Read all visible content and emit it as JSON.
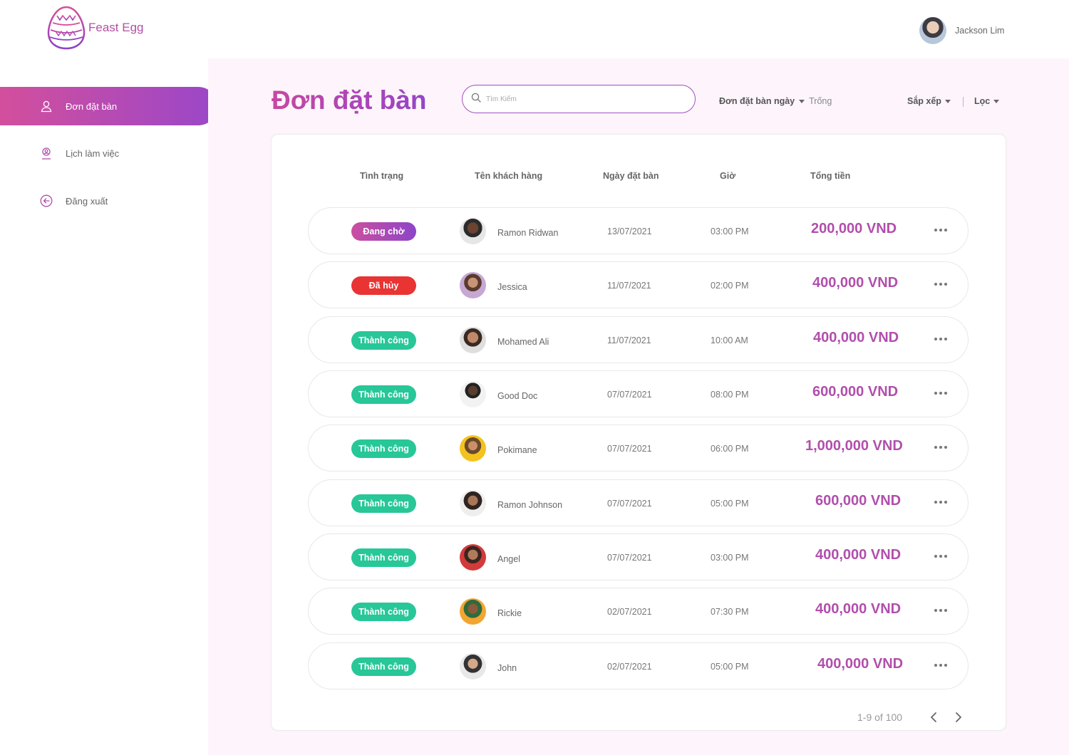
{
  "app": {
    "name": "Feast Egg"
  },
  "user": {
    "name": "Jackson Lim"
  },
  "sidebar": {
    "items": [
      {
        "label": "Đơn đặt bàn",
        "active": true,
        "icon": "user-icon"
      },
      {
        "label": "Lịch làm việc",
        "active": false,
        "icon": "location-user-icon"
      },
      {
        "label": "Đăng xuất",
        "active": false,
        "icon": "logout-arrow-icon"
      }
    ]
  },
  "header": {
    "title": "Đơn đặt bàn",
    "search_placeholder": "Tìm Kiếm",
    "filter_date_label": "Đơn đặt bàn ngày",
    "filter_date_value": "Trống",
    "sort_label": "Sắp xếp",
    "filter_label": "Lọc"
  },
  "table": {
    "columns": [
      "Tình trạng",
      "Tên khách hàng",
      "Ngày đặt bàn",
      "Giờ",
      "Tổng tiền"
    ],
    "rows": [
      {
        "status": "Đang chờ",
        "status_type": "pending",
        "customer": "Ramon Ridwan",
        "date": "13/07/2021",
        "time": "03:00 PM",
        "total": "200,000 VND"
      },
      {
        "status": "Đã hủy",
        "status_type": "cancel",
        "customer": "Jessica",
        "date": "11/07/2021",
        "time": "02:00 PM",
        "total": "400,000 VND"
      },
      {
        "status": "Thành công",
        "status_type": "success",
        "customer": "Mohamed Ali",
        "date": "11/07/2021",
        "time": "10:00 AM",
        "total": "400,000 VND"
      },
      {
        "status": "Thành công",
        "status_type": "success",
        "customer": "Good Doc",
        "date": "07/07/2021",
        "time": "08:00 PM",
        "total": "600,000 VND"
      },
      {
        "status": "Thành công",
        "status_type": "success",
        "customer": "Pokimane",
        "date": "07/07/2021",
        "time": "06:00 PM",
        "total": "1,000,000 VND"
      },
      {
        "status": "Thành công",
        "status_type": "success",
        "customer": "Ramon Johnson",
        "date": "07/07/2021",
        "time": "05:00 PM",
        "total": "600,000 VND"
      },
      {
        "status": "Thành công",
        "status_type": "success",
        "customer": "Angel",
        "date": "07/07/2021",
        "time": "03:00 PM",
        "total": "400,000 VND"
      },
      {
        "status": "Thành công",
        "status_type": "success",
        "customer": "Rickie",
        "date": "02/07/2021",
        "time": "07:30 PM",
        "total": "400,000 VND"
      },
      {
        "status": "Thành công",
        "status_type": "success",
        "customer": "John",
        "date": "02/07/2021",
        "time": "05:00 PM",
        "total": "400,000 VND"
      }
    ]
  },
  "pagination": {
    "text": "1-9 of 100"
  },
  "colors": {
    "accent": "#b14fac",
    "pending": "#a64cc0",
    "cancel": "#ea3333",
    "success": "#27c798"
  }
}
